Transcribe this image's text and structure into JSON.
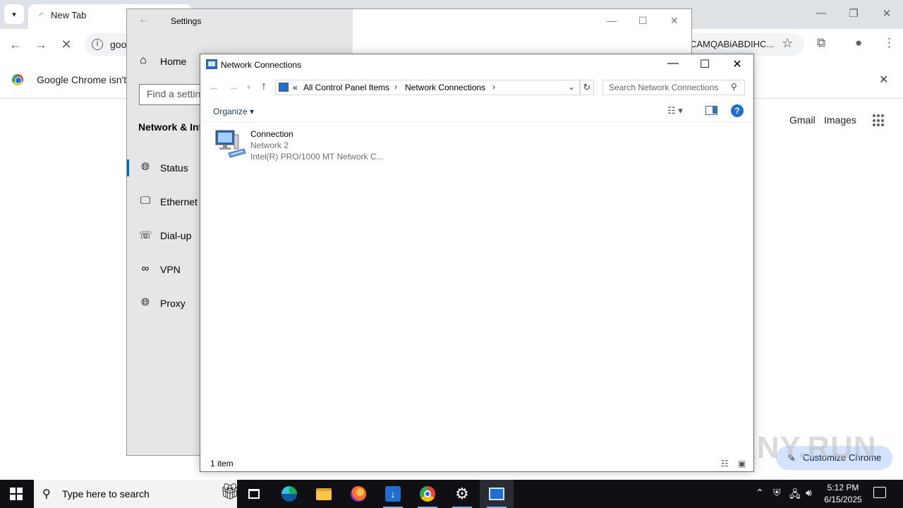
{
  "chrome": {
    "tab_title": "New Tab",
    "omnibox_left_text": "goo",
    "omnibox_right_text": "CAMQABiABDIHC...",
    "infobar_text": "Google Chrome isn't y",
    "gmail_label": "Gmail",
    "images_label": "Images",
    "customize_label": "Customize Chrome",
    "watermark": "ANY.RUN"
  },
  "settings": {
    "title": "Settings",
    "home_label": "Home",
    "find_placeholder": "Find a settin",
    "section_title": "Network & Int",
    "items": [
      {
        "label": "Status",
        "icon": "globe-icon"
      },
      {
        "label": "Ethernet",
        "icon": "ethernet-icon"
      },
      {
        "label": "Dial-up",
        "icon": "dialup-icon"
      },
      {
        "label": "VPN",
        "icon": "vpn-icon"
      },
      {
        "label": "Proxy",
        "icon": "globe-icon"
      }
    ],
    "selected_item": "Status"
  },
  "network_connections": {
    "title": "Network Connections",
    "breadcrumb": {
      "prefix": "«",
      "items": [
        "All Control Panel Items",
        "Network Connections"
      ]
    },
    "search_placeholder": "Search Network Connections",
    "organize_label": "Organize",
    "connection": {
      "name": "Connection",
      "network": "Network 2",
      "adapter": "Intel(R) PRO/1000 MT Network C..."
    },
    "status_count": "1 item"
  },
  "taskbar": {
    "search_placeholder": "Type here to search",
    "time": "5:12 PM",
    "date": "6/15/2025",
    "apps": [
      "task-view",
      "edge",
      "file-explorer",
      "firefox",
      "downloader",
      "chrome",
      "settings",
      "network-connections"
    ]
  },
  "colors": {
    "chrome_tabstrip": "#dee1e6",
    "settings_sidebar": "#e6e6e6",
    "accent_blue": "#0067c0",
    "taskbar": "#101014",
    "customize_pill": "#d3e3fd"
  }
}
